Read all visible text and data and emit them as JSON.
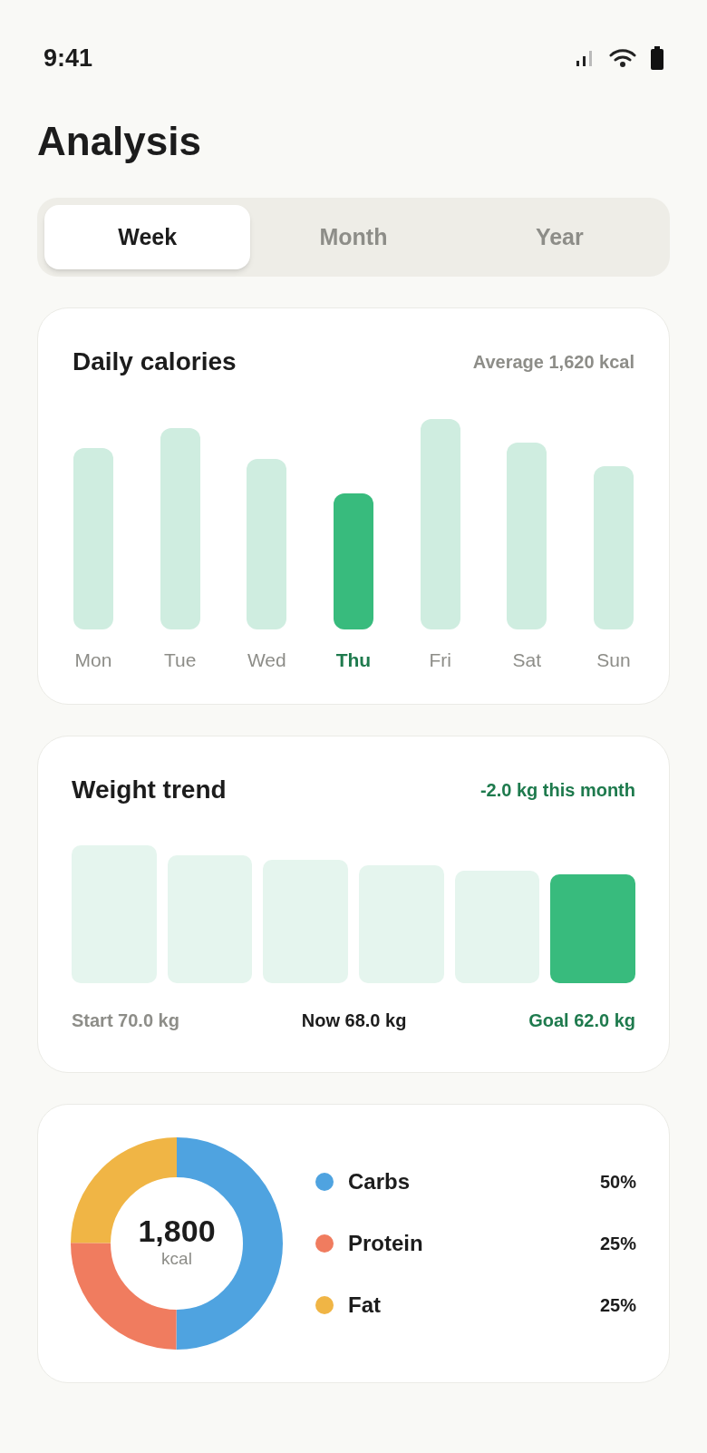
{
  "status_bar": {
    "time": "9:41"
  },
  "title": "Analysis",
  "tabs": [
    {
      "label": "Week",
      "selected": true
    },
    {
      "label": "Month",
      "selected": false
    },
    {
      "label": "Year",
      "selected": false
    }
  ],
  "daily_calories": {
    "title": "Daily calories",
    "summary": "Average 1,620 kcal",
    "days": [
      {
        "label": "Mon",
        "selected": false
      },
      {
        "label": "Tue",
        "selected": false
      },
      {
        "label": "Wed",
        "selected": false
      },
      {
        "label": "Thu",
        "selected": true
      },
      {
        "label": "Fri",
        "selected": false
      },
      {
        "label": "Sat",
        "selected": false
      },
      {
        "label": "Sun",
        "selected": false
      }
    ]
  },
  "weight_trend": {
    "title": "Weight trend",
    "change": "-2.0 kg this month",
    "start": "Start 70.0 kg",
    "now": "Now 68.0 kg",
    "goal": "Goal 62.0 kg"
  },
  "macros": {
    "total": "1,800",
    "unit": "kcal",
    "items": [
      {
        "name": "Carbs",
        "share": "50%",
        "color": "#4fa3e0"
      },
      {
        "name": "Protein",
        "share": "25%",
        "color": "#f07c5f"
      },
      {
        "name": "Fat",
        "share": "25%",
        "color": "#f0b545"
      }
    ]
  }
}
